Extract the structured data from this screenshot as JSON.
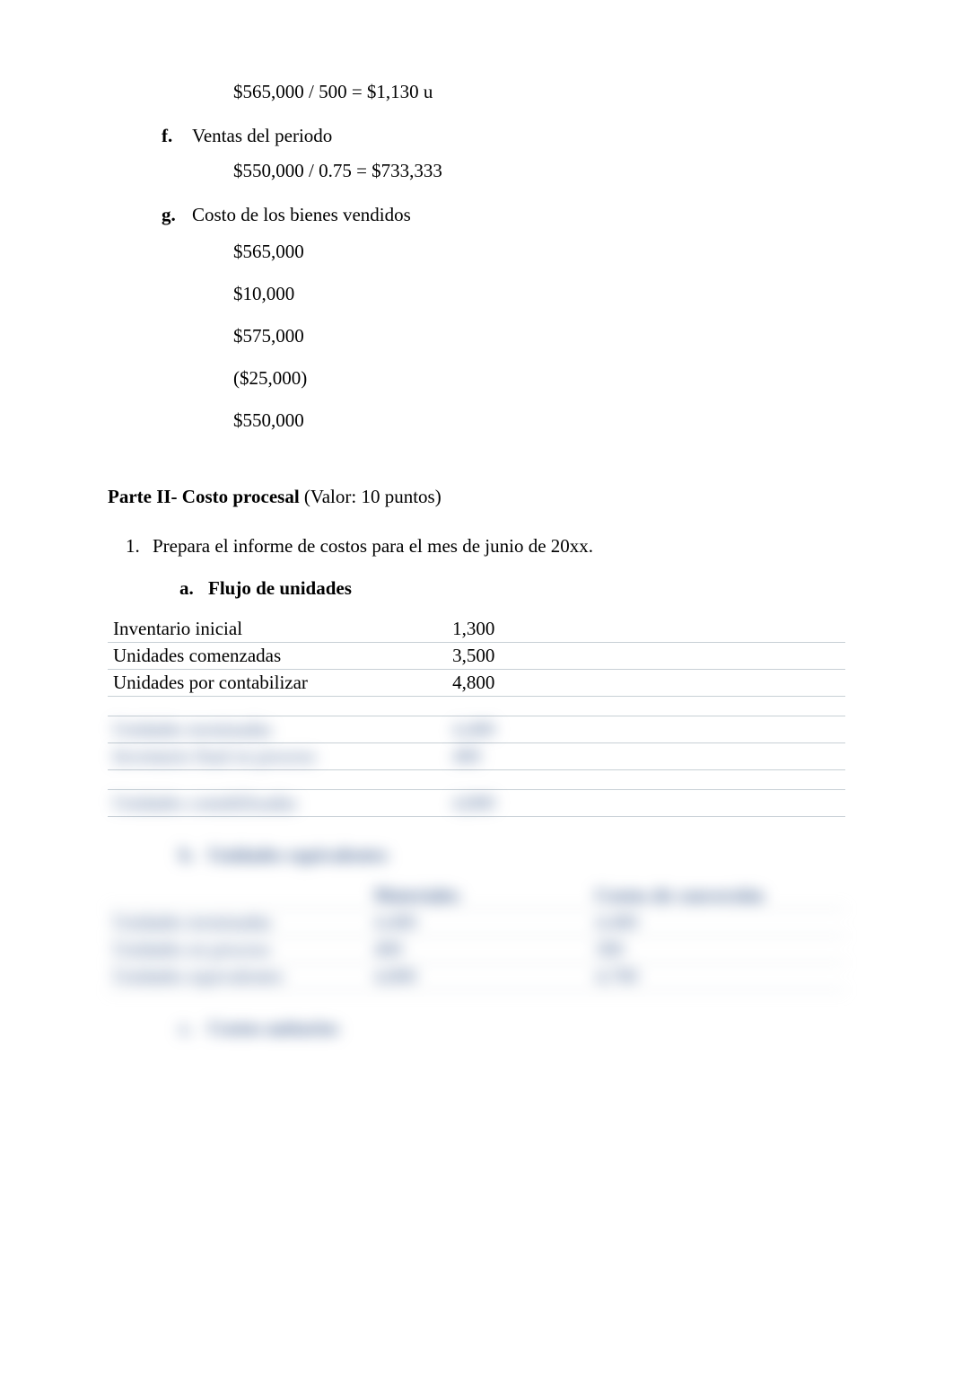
{
  "top": {
    "calc1": "$565,000 / 500 = $1,130 u",
    "item_f_marker": "f.",
    "item_f_text": "Ventas del periodo",
    "calc2": "$550,000 / 0.75 = $733,333",
    "item_g_marker": "g.",
    "item_g_text": "Costo de los bienes vendidos",
    "vals": [
      "$565,000",
      "$10,000",
      "$575,000",
      "($25,000)",
      "$550,000"
    ]
  },
  "part2": {
    "title_bold": "Parte II- Costo procesal",
    "title_rest": " (Valor: 10 puntos)",
    "item1_marker": "1.",
    "item1_text": "Prepara el informe de costos para el mes de junio de 20xx.",
    "sub_a_marker": "a.",
    "sub_a_text": "Flujo de unidades",
    "table_a": {
      "rows": [
        {
          "label": "Inventario inicial",
          "val": "1,300"
        },
        {
          "label": "Unidades comenzadas",
          "val": "3,500"
        },
        {
          "label": "Unidades por contabilizar",
          "val": "4,800"
        }
      ],
      "blurred_rows": [
        {
          "label": "Unidades terminadas",
          "val": "4,400"
        },
        {
          "label": "Inventario final en proceso",
          "val": "400"
        }
      ],
      "blurred_total": {
        "label": "Unidades contabilizadas",
        "val": "4,800"
      }
    },
    "sub_b_marker": "b.",
    "sub_b_text": "Unidades equivalentes",
    "table_b": {
      "head": {
        "c2": "Materiales",
        "c3": "Costos de conversión"
      },
      "rows": [
        {
          "c1": "Unidades terminadas",
          "c2": "4,400",
          "c3": "4,400"
        },
        {
          "c1": "Unidades en proceso",
          "c2": "400",
          "c3": "300"
        },
        {
          "c1": "Unidades equivalentes",
          "c2": "4,800",
          "c3": "4,700"
        }
      ]
    },
    "sub_c_marker": "c.",
    "sub_c_text": "Costos unitarios"
  }
}
